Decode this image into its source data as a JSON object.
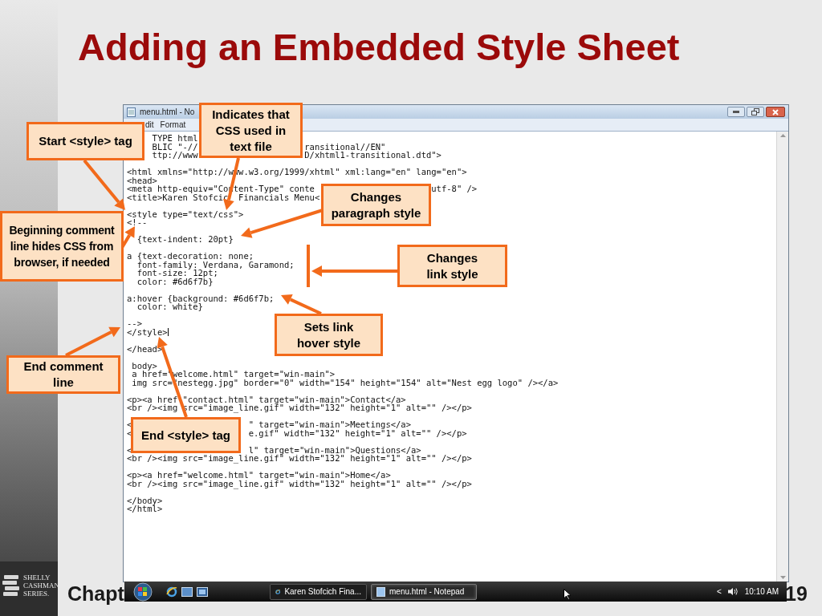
{
  "slide": {
    "title": "Adding an Embedded Style Sheet",
    "footer_left": "Chapt",
    "page_number": "19",
    "logo": [
      "SHELLY",
      "CASHMAN",
      "SERIES."
    ]
  },
  "notepad": {
    "title": "menu.html - No",
    "menu": [
      "dit",
      "Format"
    ],
    "blocks": [
      [
        [
          "TYPE html"
        ],
        [
          "BLIC \"-//",
          "ransitional//EN\""
        ],
        [
          "ttp://www",
          "D/xhtml1-transitional.dtd\">"
        ]
      ],
      [
        [
          "<html xmlns=\"http://www.w3.org/1999/xhtml\" xml:lang=\"en\" lang=\"en\">"
        ],
        [
          "<head>"
        ],
        [
          "<meta http-equiv=\"Content-Type\" conte",
          "utf-8\" />"
        ],
        [
          "<title>Karen Stofcic",
          "Financials Menu<"
        ]
      ],
      [
        [
          "<style type=\"text/css\">"
        ],
        [
          "<!--"
        ]
      ],
      [
        [
          "{text-indent: 20pt}"
        ]
      ],
      [
        [
          "a {text-decoration: none;"
        ],
        [
          "  font-family: Verdana, Garamond;"
        ],
        [
          "  font-size: 12pt;"
        ],
        [
          "  color: #6d6f7b}"
        ]
      ],
      [
        [
          "a:hover {background: #6d6f7b;"
        ],
        [
          "  color: white}"
        ]
      ],
      [
        [
          "-->"
        ],
        [
          "</style>"
        ]
      ],
      [
        [
          "</head>"
        ]
      ],
      [
        [
          "body>"
        ],
        [
          "a href=\"welcome.html\" target=\"win-main\">"
        ],
        [
          "img src=\"nestegg.jpg\" border=\"0\" width=\"154\" height=\"154\" alt=\"Nest egg logo\" /></a>"
        ]
      ],
      [
        [
          "<p><a href",
          "\"contact.html\" target=\"win-main\">Contact</a>"
        ],
        [
          "<br /><img src=\"image_line.gif\" width=\"132\" height=\"1\" alt=\"\" /></p>"
        ]
      ],
      [
        [
          "<",
          "\" target=\"win-main\">Meetings</a>"
        ],
        [
          "<",
          "e.gif\" width=\"132\" height=\"1\" alt=\"\" /></p>"
        ]
      ],
      [
        [
          "<",
          "l\" target=\"win-main\">Questions</a>"
        ],
        [
          "<br /><img src=\"image_line.gif\" width=\"132\" height=\"1\" alt=\"\" /></p>"
        ]
      ],
      [
        [
          "<p><a href=\"welcome.html\" target=\"win-main\">Home</a>"
        ],
        [
          "<br /><img src=\"image_line.gif\" width=\"132\" height=\"1\" alt=\"\" /></p>"
        ]
      ],
      [
        [
          "</body>"
        ],
        [
          "</html>"
        ]
      ]
    ]
  },
  "callouts": [
    {
      "text": "Start <style> tag"
    },
    {
      "text": "Indicates that CSS used in text file"
    },
    {
      "text": "Changes paragraph style"
    },
    {
      "text": "Beginning comment line hides CSS from browser, if needed"
    },
    {
      "text": "Changes link style"
    },
    {
      "text": "Sets link hover style"
    },
    {
      "text": "End comment line"
    },
    {
      "text": "End <style> tag"
    }
  ],
  "taskbar": {
    "buttons": [
      {
        "label": "Karen Stofcich Fina...",
        "selected": false
      },
      {
        "label": "menu.html - Notepad",
        "selected": true
      }
    ],
    "tray_chevron": "<",
    "clock": "10:10 AM"
  }
}
